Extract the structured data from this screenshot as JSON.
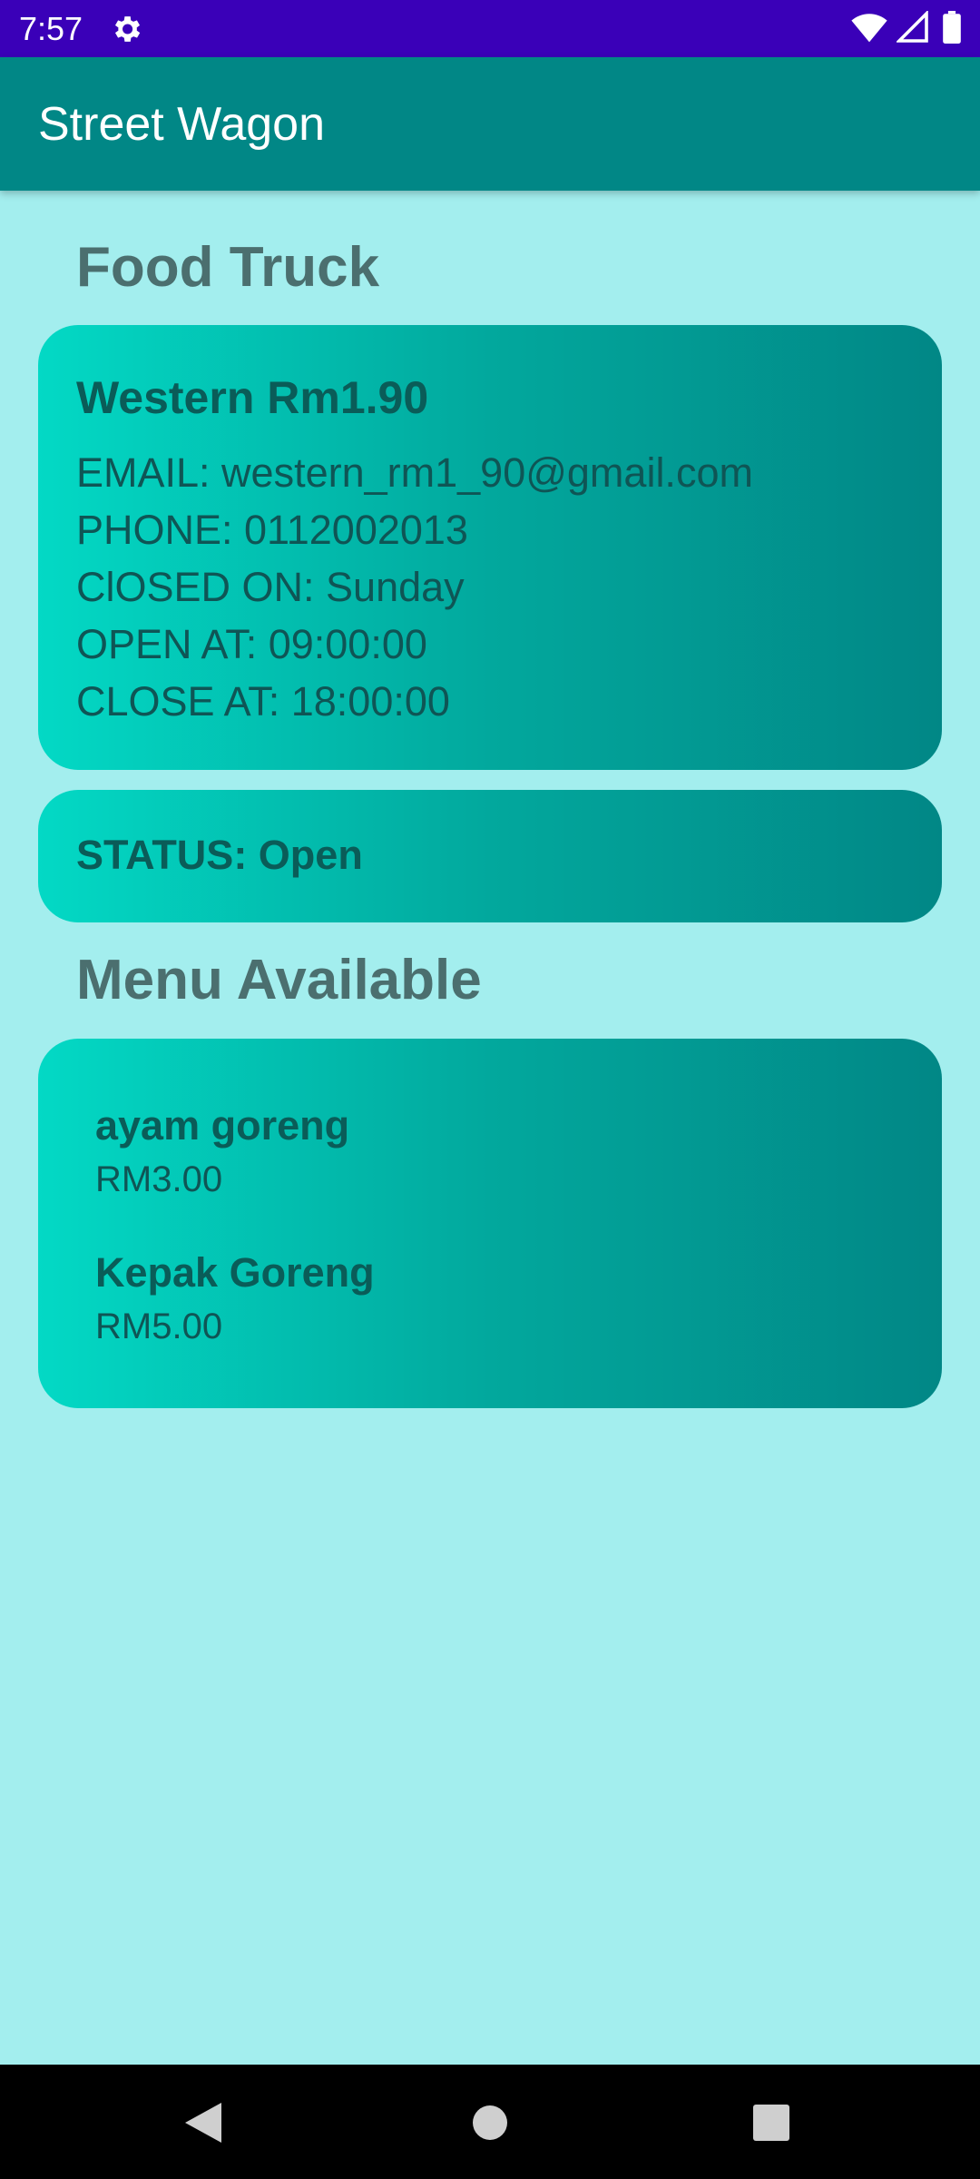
{
  "status_bar": {
    "time": "7:57",
    "settings_icon": "gear-icon",
    "wifi_icon": "wifi-icon",
    "signal_icon": "signal-icon",
    "battery_icon": "battery-icon",
    "background": "#3a00b8"
  },
  "app_bar": {
    "title": "Street Wagon",
    "background": "#018786"
  },
  "food_truck_section": {
    "heading": "Food Truck"
  },
  "truck_card": {
    "name": "Western Rm1.90",
    "email": "EMAIL: western_rm1_90@gmail.com",
    "phone": "PHONE: 0112002013",
    "closed_on": "ClOSED ON: Sunday",
    "open_at": "OPEN AT: 09:00:00",
    "close_at": "CLOSE AT: 18:00:00"
  },
  "status_card": {
    "status": "STATUS: Open"
  },
  "menu_section": {
    "heading": "Menu Available",
    "items": [
      {
        "name": "ayam goreng",
        "price": "RM3.00"
      },
      {
        "name": "Kepak Goreng",
        "price": "RM5.00"
      }
    ]
  },
  "nav_bar": {
    "back_icon": "back-triangle-icon",
    "home_icon": "home-circle-icon",
    "recents_icon": "recents-square-icon"
  },
  "colors": {
    "background": "#a3eeee",
    "card_gradient_start": "#03d9c5",
    "card_gradient_end": "#018786",
    "heading": "#4b6f6f"
  }
}
